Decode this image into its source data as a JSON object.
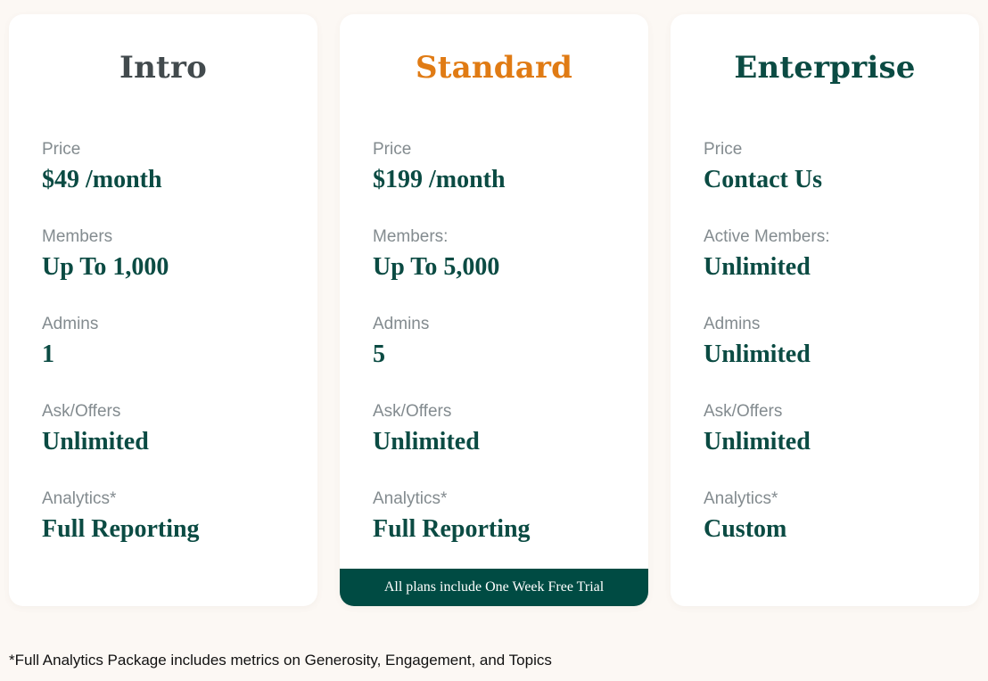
{
  "colors": {
    "background": "#fcf8f4",
    "card": "#ffffff",
    "value_text": "#0b4b43",
    "label_text": "#838b8f",
    "banner": "#004b43"
  },
  "plans": [
    {
      "name": "Intro",
      "title_color": "#424a4d",
      "features": [
        {
          "label": "Price",
          "value": "$49 /month"
        },
        {
          "label": "Members",
          "value": "Up To 1,000"
        },
        {
          "label": "Admins",
          "value": "1"
        },
        {
          "label": "Ask/Offers",
          "value": "Unlimited"
        },
        {
          "label": "Analytics*",
          "value": "Full Reporting"
        }
      ]
    },
    {
      "name": "Standard",
      "title_color": "#e07b14",
      "features": [
        {
          "label": "Price",
          "value": "$199 /month"
        },
        {
          "label": "Members:",
          "value": "Up To 5,000"
        },
        {
          "label": "Admins",
          "value": "5"
        },
        {
          "label": "Ask/Offers",
          "value": "Unlimited"
        },
        {
          "label": "Analytics*",
          "value": "Full Reporting"
        }
      ],
      "banner": "All plans include One Week Free Trial"
    },
    {
      "name": "Enterprise",
      "title_color": "#0b4b43",
      "features": [
        {
          "label": "Price",
          "value": "Contact Us"
        },
        {
          "label": "Active Members:",
          "value": "Unlimited"
        },
        {
          "label": "Admins",
          "value": "Unlimited"
        },
        {
          "label": "Ask/Offers",
          "value": "Unlimited"
        },
        {
          "label": "Analytics*",
          "value": "Custom"
        }
      ]
    }
  ],
  "footnote": "*Full Analytics Package includes metrics on Generosity, Engagement, and Topics"
}
